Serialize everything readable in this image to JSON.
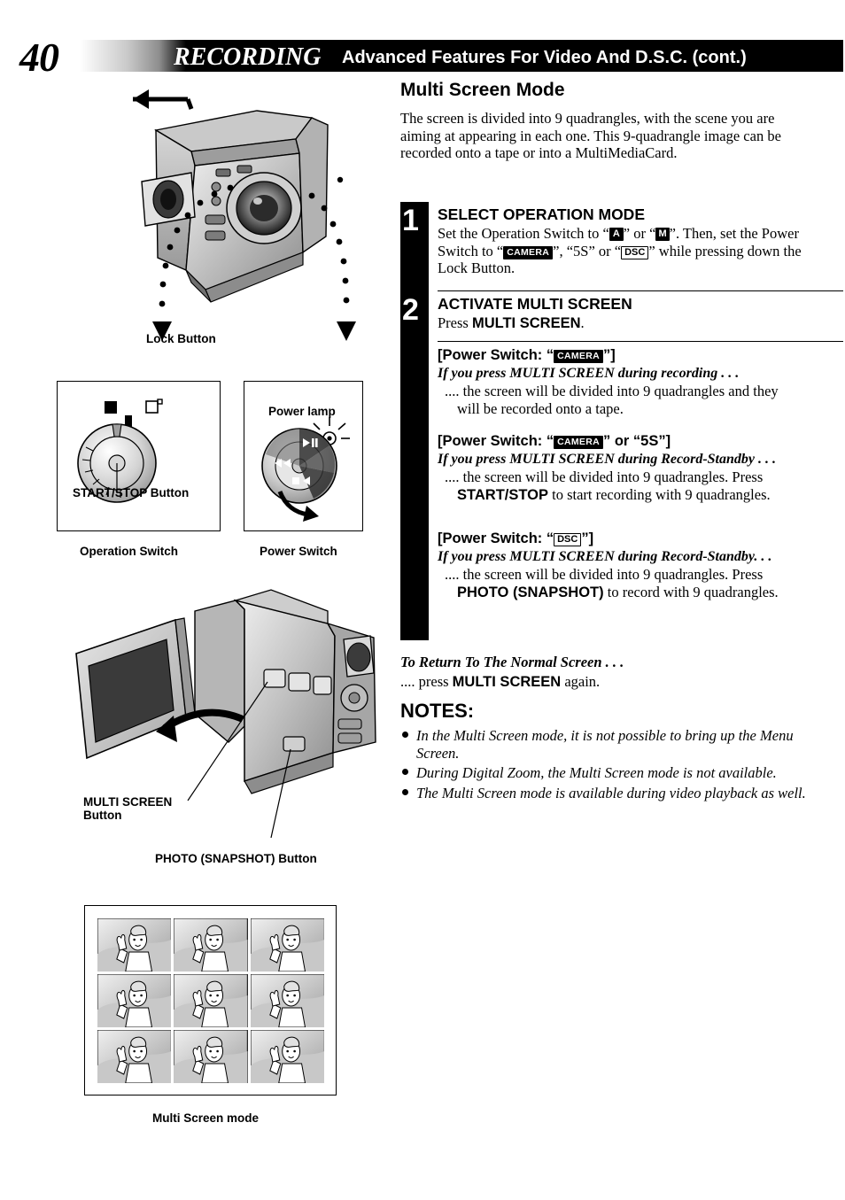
{
  "header": {
    "page_number": "40",
    "section_title": "RECORDING",
    "subtitle": "Advanced Features For Video And D.S.C. (cont.)"
  },
  "main": {
    "title": "Multi Screen Mode",
    "intro": "The screen is divided into 9 quadrangles, with the scene you are aiming at appearing in each one. This 9-quadrangle image can be recorded onto a tape or into a MultiMediaCard."
  },
  "steps": [
    {
      "number": "1",
      "heading": "SELECT OPERATION MODE",
      "text_parts": {
        "p1": "Set the Operation Switch to “",
        "icon1": "A",
        "p2": "” or “",
        "icon2": "M",
        "p3": "”. Then, set the Power Switch to “",
        "icon3": "CAMERA",
        "p4": "”, “5S” or “",
        "icon4": "DSC",
        "p5": "” while pressing down the Lock Button."
      }
    },
    {
      "number": "2",
      "heading": "ACTIVATE MULTI SCREEN",
      "press_label": "Press ",
      "press_bold": "MULTI SCREEN",
      "press_end": "."
    }
  ],
  "switch_blocks": [
    {
      "head_pre": "[Power Switch: “",
      "head_icon": "CAMERA",
      "head_post": "”]",
      "cond": "If you press MULTI SCREEN during recording . . .",
      "result": ".... the screen will be divided into 9 quadrangles and they will be recorded onto a tape."
    },
    {
      "head_pre": "[Power Switch: “",
      "head_icon": "CAMERA",
      "head_post": "” or “5S”]",
      "cond": "If you press MULTI SCREEN during Record-Standby . . .",
      "result_pre": ".... the screen will be divided into 9 quadrangles. Press ",
      "result_bold": "START/STOP",
      "result_post": " to start recording with 9 quadrangles."
    },
    {
      "head_pre": "[Power Switch: “",
      "head_icon": "DSC",
      "head_post": "”]",
      "cond": "If you press MULTI SCREEN during Record-Standby. . .",
      "result_pre": ".... the screen will be divided into 9 quadrangles. Press ",
      "result_bold": "PHOTO (SNAPSHOT)",
      "result_post": " to record with 9 quadrangles."
    }
  ],
  "return_block": {
    "line1": "To Return To The Normal Screen . . .",
    "line2_pre": ".... press ",
    "line2_bold": "MULTI SCREEN",
    "line2_post": " again."
  },
  "notes": {
    "heading": "NOTES:",
    "items": [
      "In the Multi Screen mode, it is not possible to bring up the Menu Screen.",
      "During Digital Zoom, the Multi Screen mode is not available.",
      "The Multi Screen mode is available during video playback as well."
    ]
  },
  "figure_captions": {
    "lock_button": "Lock Button",
    "start_stop_button": "START/STOP Button",
    "power_lamp": "Power lamp",
    "operation_switch": "Operation Switch",
    "power_switch": "Power Switch",
    "multi_screen_button": "MULTI SCREEN\nButton",
    "multi_screen_button_l1": "MULTI SCREEN",
    "multi_screen_button_l2": "Button",
    "photo_snapshot_button": "PHOTO (SNAPSHOT) Button",
    "multi_screen_mode": "Multi Screen mode"
  },
  "colors": {
    "ink": "#000000",
    "page": "#ffffff",
    "device_gray": "#b9b9b9",
    "device_dark": "#6e6e6e"
  }
}
